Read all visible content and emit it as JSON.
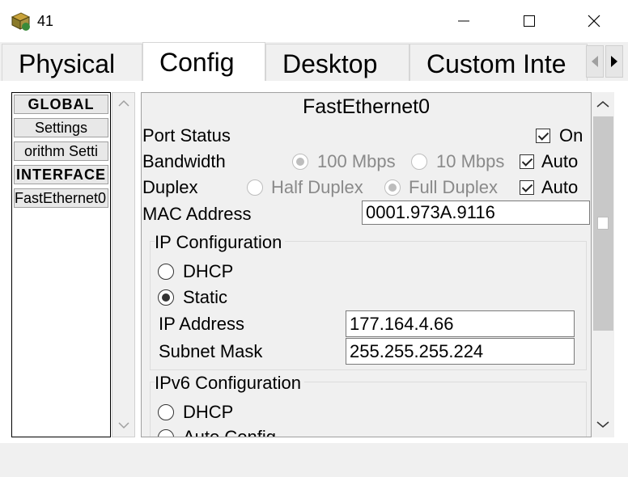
{
  "window": {
    "title": "41",
    "icons": {
      "app": "router-device-icon",
      "minimize": "minimize-icon",
      "maximize": "maximize-icon",
      "close": "close-icon"
    }
  },
  "tabs": [
    {
      "label": "Physical",
      "active": false
    },
    {
      "label": "Config",
      "active": true
    },
    {
      "label": "Desktop",
      "active": false
    },
    {
      "label": "Custom Inte",
      "active": false
    }
  ],
  "sidebar": {
    "items": [
      {
        "label": "GLOBAL",
        "type": "header"
      },
      {
        "label": "Settings",
        "type": "item"
      },
      {
        "label": "orithm Setti",
        "type": "item"
      },
      {
        "label": "INTERFACE",
        "type": "header"
      },
      {
        "label": "FastEthernet0",
        "type": "item",
        "selected": true
      }
    ]
  },
  "panel": {
    "title": "FastEthernet0",
    "port_status": {
      "label": "Port Status",
      "checkbox_label": "On",
      "checked": true
    },
    "bandwidth": {
      "label": "Bandwidth",
      "opt1": "100 Mbps",
      "opt2": "10 Mbps",
      "auto_label": "Auto",
      "auto_checked": true,
      "selected": "100 Mbps"
    },
    "duplex": {
      "label": "Duplex",
      "opt1": "Half Duplex",
      "opt2": "Full Duplex",
      "auto_label": "Auto",
      "auto_checked": true,
      "selected": "Full Duplex"
    },
    "mac": {
      "label": "MAC Address",
      "value": "0001.973A.9116"
    },
    "ip_config": {
      "title": "IP Configuration",
      "dhcp_label": "DHCP",
      "static_label": "Static",
      "selected": "Static",
      "ip_label": "IP Address",
      "ip_value": "177.164.4.66",
      "mask_label": "Subnet Mask",
      "mask_value": "255.255.255.224"
    },
    "ipv6_config": {
      "title": "IPv6 Configuration",
      "dhcp_label": "DHCP",
      "auto_label": "Auto Config"
    }
  },
  "colors": {
    "disabled_text": "#8a8a8a",
    "window_bg": "#f0f0f0",
    "panel_bg": "#ffffff"
  }
}
